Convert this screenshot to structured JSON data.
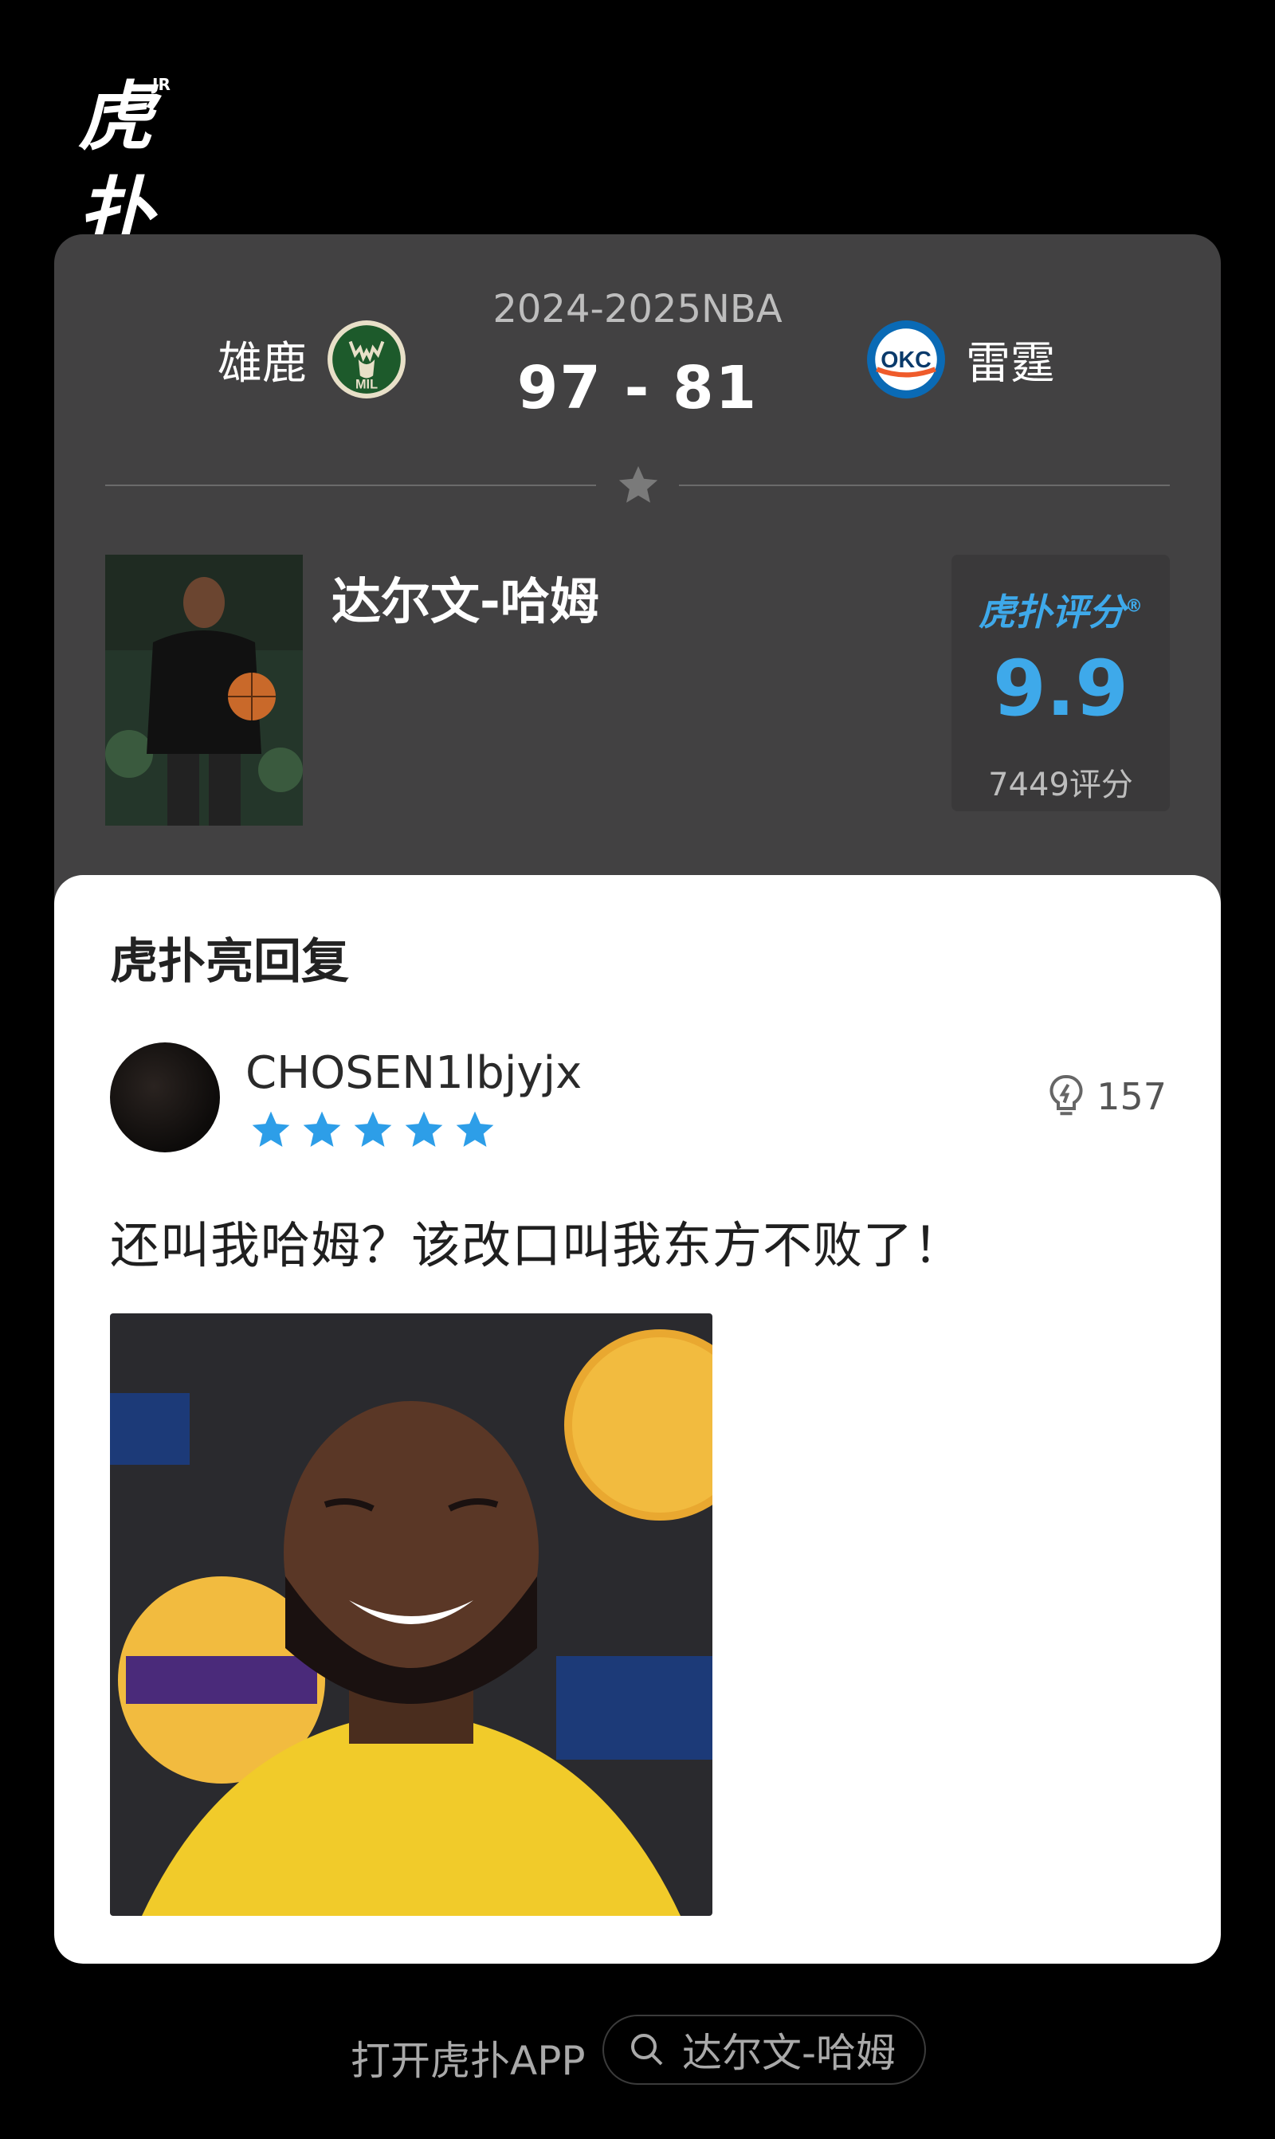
{
  "app": {
    "logo_text": "虎扑",
    "logo_sup": "JR"
  },
  "match": {
    "league": "2024-2025NBA",
    "score": "97  -  81",
    "home_team": "雄鹿",
    "away_team": "雷霆",
    "home_logo_text": "MIL",
    "away_logo_text": "OKC"
  },
  "player": {
    "name": "达尔文-哈姆"
  },
  "rating": {
    "brand": "虎扑评分",
    "brand_mark": "®",
    "score": "9.9",
    "count": "7449评分"
  },
  "reply": {
    "title": "虎扑亮回复",
    "username": "CHOSEN1lbjyjx",
    "stars": 5,
    "light_count": "157",
    "text": "还叫我哈姆？该改口叫我东方不败了！"
  },
  "footer": {
    "open_app": "打开虎扑APP",
    "search_text": "达尔文-哈姆"
  },
  "colors": {
    "background": "#000000",
    "card": "#424142",
    "accent_blue": "#3ea9ea",
    "star_blue": "#2d9ee8"
  }
}
